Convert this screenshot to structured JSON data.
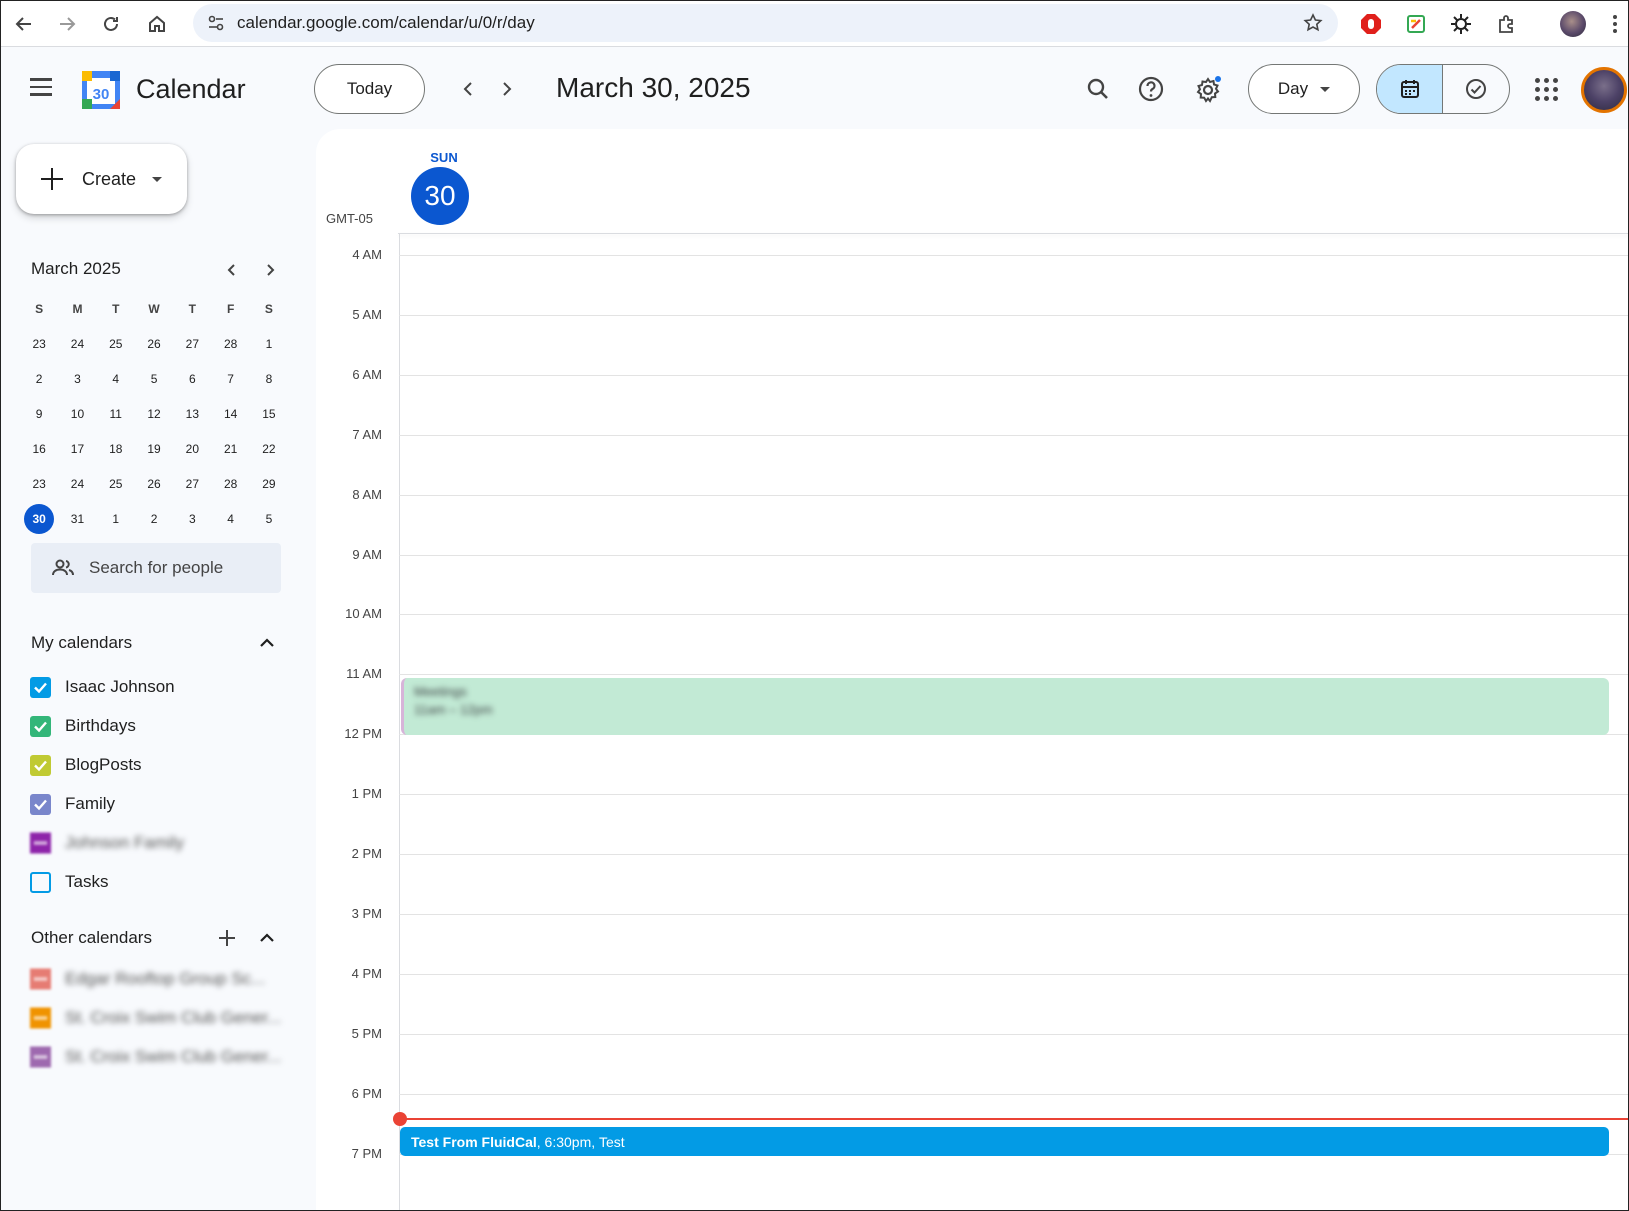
{
  "browser": {
    "url": "calendar.google.com/calendar/u/0/r/day"
  },
  "header": {
    "app_title": "Calendar",
    "logo_day": "30",
    "today_label": "Today",
    "date_title": "March 30, 2025",
    "view_label": "Day"
  },
  "sidebar": {
    "create_label": "Create",
    "mini_calendar": {
      "title": "March 2025",
      "weekdays": [
        "S",
        "M",
        "T",
        "W",
        "T",
        "F",
        "S"
      ],
      "weeks": [
        [
          "23",
          "24",
          "25",
          "26",
          "27",
          "28",
          "1"
        ],
        [
          "2",
          "3",
          "4",
          "5",
          "6",
          "7",
          "8"
        ],
        [
          "9",
          "10",
          "11",
          "12",
          "13",
          "14",
          "15"
        ],
        [
          "16",
          "17",
          "18",
          "19",
          "20",
          "21",
          "22"
        ],
        [
          "23",
          "24",
          "25",
          "26",
          "27",
          "28",
          "29"
        ],
        [
          "30",
          "31",
          "1",
          "2",
          "3",
          "4",
          "5"
        ]
      ],
      "selected": "30"
    },
    "search_people_placeholder": "Search for people",
    "my_calendars": {
      "title": "My calendars",
      "items": [
        {
          "label": "Isaac Johnson",
          "color": "#039be5",
          "checked": true
        },
        {
          "label": "Birthdays",
          "color": "#33b679",
          "checked": true
        },
        {
          "label": "BlogPosts",
          "color": "#c0ca33",
          "checked": true
        },
        {
          "label": "Family",
          "color": "#7986cb",
          "checked": true
        },
        {
          "label": "Johnson Family",
          "color": "#8e24aa",
          "checked": false,
          "blurred": true
        },
        {
          "label": "Tasks",
          "color": "#039be5",
          "checked": false
        }
      ]
    },
    "other_calendars": {
      "title": "Other calendars",
      "items": [
        {
          "label": "Edgar Rooftop Group Sc...",
          "color": "#e67c73",
          "blurred": true
        },
        {
          "label": "St. Croix Swim Club Gener...",
          "color": "#f09300",
          "blurred": true
        },
        {
          "label": "St. Croix Swim Club Gener...",
          "color": "#9e69af",
          "blurred": true
        }
      ]
    }
  },
  "day_view": {
    "dow": "SUN",
    "day_number": "30",
    "timezone": "GMT-05",
    "hours": [
      "4 AM",
      "5 AM",
      "6 AM",
      "7 AM",
      "8 AM",
      "9 AM",
      "10 AM",
      "11 AM",
      "12 PM",
      "1 PM",
      "2 PM",
      "3 PM",
      "4 PM",
      "5 PM",
      "6 PM",
      "7 PM"
    ],
    "events": [
      {
        "title": "Meetings",
        "time": "11am – 12pm",
        "color": "#c2ead5",
        "blurred": true
      },
      {
        "title": "Test From FluidCal",
        "time": "6:30pm",
        "location": "Test",
        "color": "#039be5"
      }
    ],
    "now_indicator_color": "#ea4335"
  },
  "colors": {
    "accent": "#0b57d0",
    "selected_segment": "#c2e7ff"
  }
}
